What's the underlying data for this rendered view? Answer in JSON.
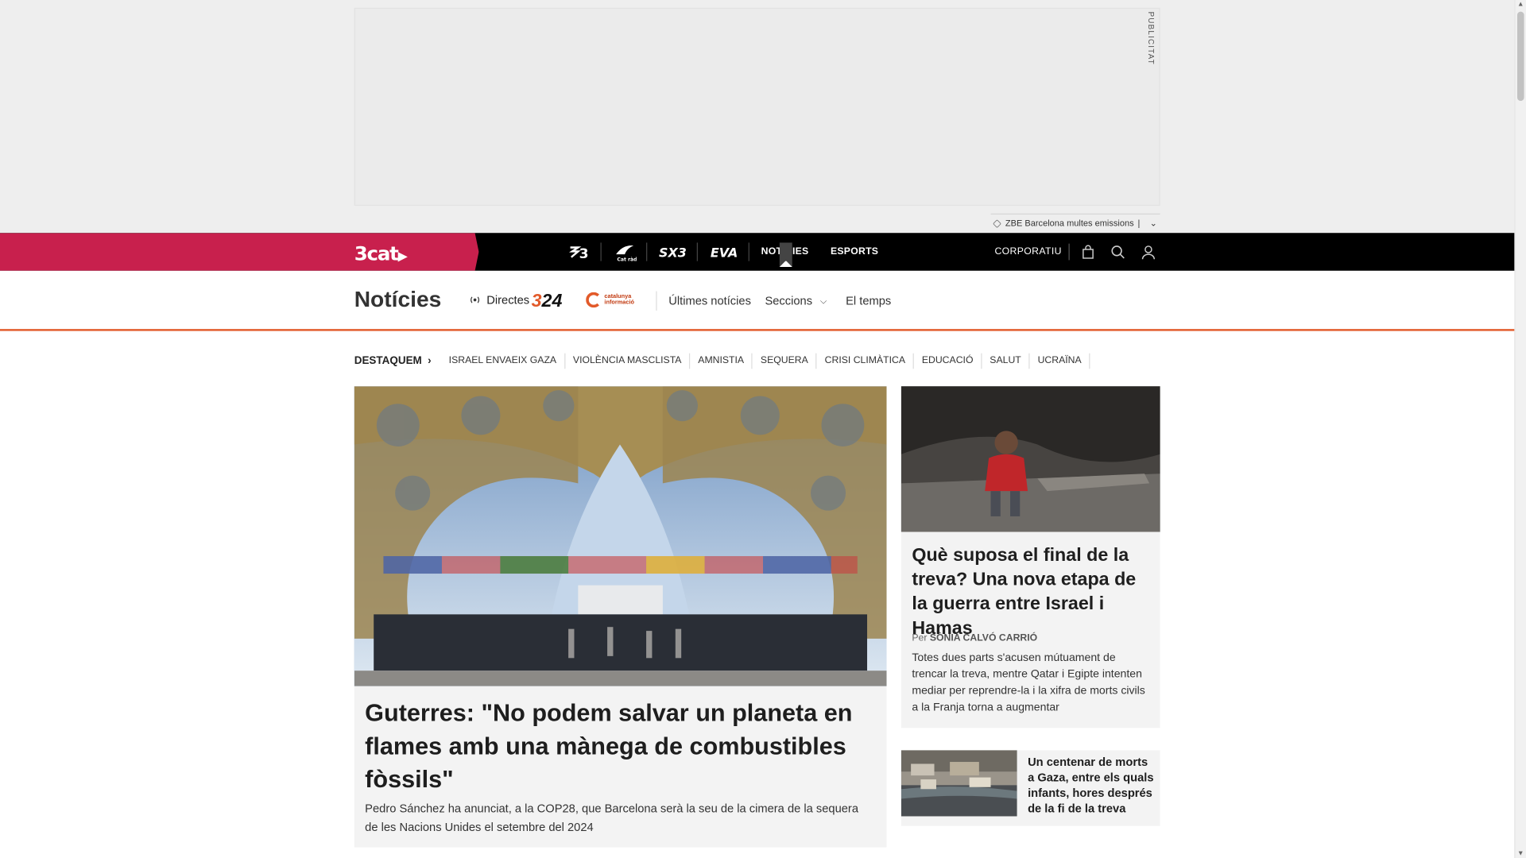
{
  "ad": {
    "label": "PUBLICITAT",
    "strip_text": "ZBE Barcelona multes emissions",
    "strip_sep": "|"
  },
  "topnav": {
    "brand": "3cat",
    "channels": [
      {
        "id": "tv3",
        "label": "≋3"
      },
      {
        "id": "catradio",
        "label": "Cat ràdio"
      },
      {
        "id": "sx3",
        "label": "SX3"
      },
      {
        "id": "eva",
        "label": "EVA"
      },
      {
        "id": "noticies",
        "label": "NOTÍCIES"
      },
      {
        "id": "esports",
        "label": "ESPORTS"
      }
    ],
    "corporate": "CORPORATIU"
  },
  "section": {
    "title": "Notícies",
    "directes": "Directes",
    "badge_324": {
      "a": "3",
      "b": "24"
    },
    "catinfo": {
      "line1": "catalunya",
      "line2": "informació"
    },
    "links": [
      "Últimes notícies",
      "Seccions",
      "El temps"
    ]
  },
  "trending": {
    "lead": "DESTAQUEM",
    "items": [
      "ISRAEL ENVAEIX GAZA",
      "VIOLÈNCIA MASCLISTA",
      "AMNISTIA",
      "SEQUERA",
      "CRISI CLIMÀTICA",
      "EDUCACIÓ",
      "SALUT",
      "UCRAÏNA"
    ]
  },
  "main_story": {
    "title": "Guterres: \"No podem salvar un planeta en flames amb una mànega de combustibles fòssils\"",
    "summary": "Pedro Sánchez ha anunciat, a la COP28, que Barcelona serà la seu de la cimera de la sequera de les Nacions Unides el setembre del 2024"
  },
  "side_story": {
    "title": "Què suposa el final de la treva? Una nova etapa de la guerra entre Israel i Hamas",
    "byline_prefix": "Per",
    "author": "SÒNIA CALVÓ CARRIÓ",
    "summary": "Totes dues parts s'acusen mútuament de trencar la treva, mentre Qatar i Egipte intenten mediar per reprendre-la i la xifra de morts civils a la Franja torna a augmentar"
  },
  "mini_story": {
    "title": "Un centenar de morts a Gaza, entre els quals infants, hores després de la fi de la treva"
  },
  "colors": {
    "brand": "#c8204d",
    "accent": "#e25a2a",
    "nav_bg": "#000000"
  }
}
